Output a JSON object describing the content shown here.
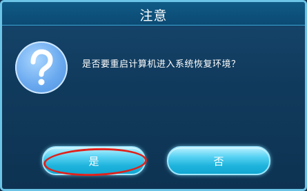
{
  "dialog": {
    "title": "注意",
    "message": "是否要重启计算机进入系统恢复环境？",
    "icon": "question-icon"
  },
  "buttons": {
    "yes_label": "是",
    "no_label": "否"
  },
  "colors": {
    "background": "#103a5c",
    "border": "#6cc4e6",
    "button": "#1eb3dc",
    "highlight": "#e0211b"
  }
}
